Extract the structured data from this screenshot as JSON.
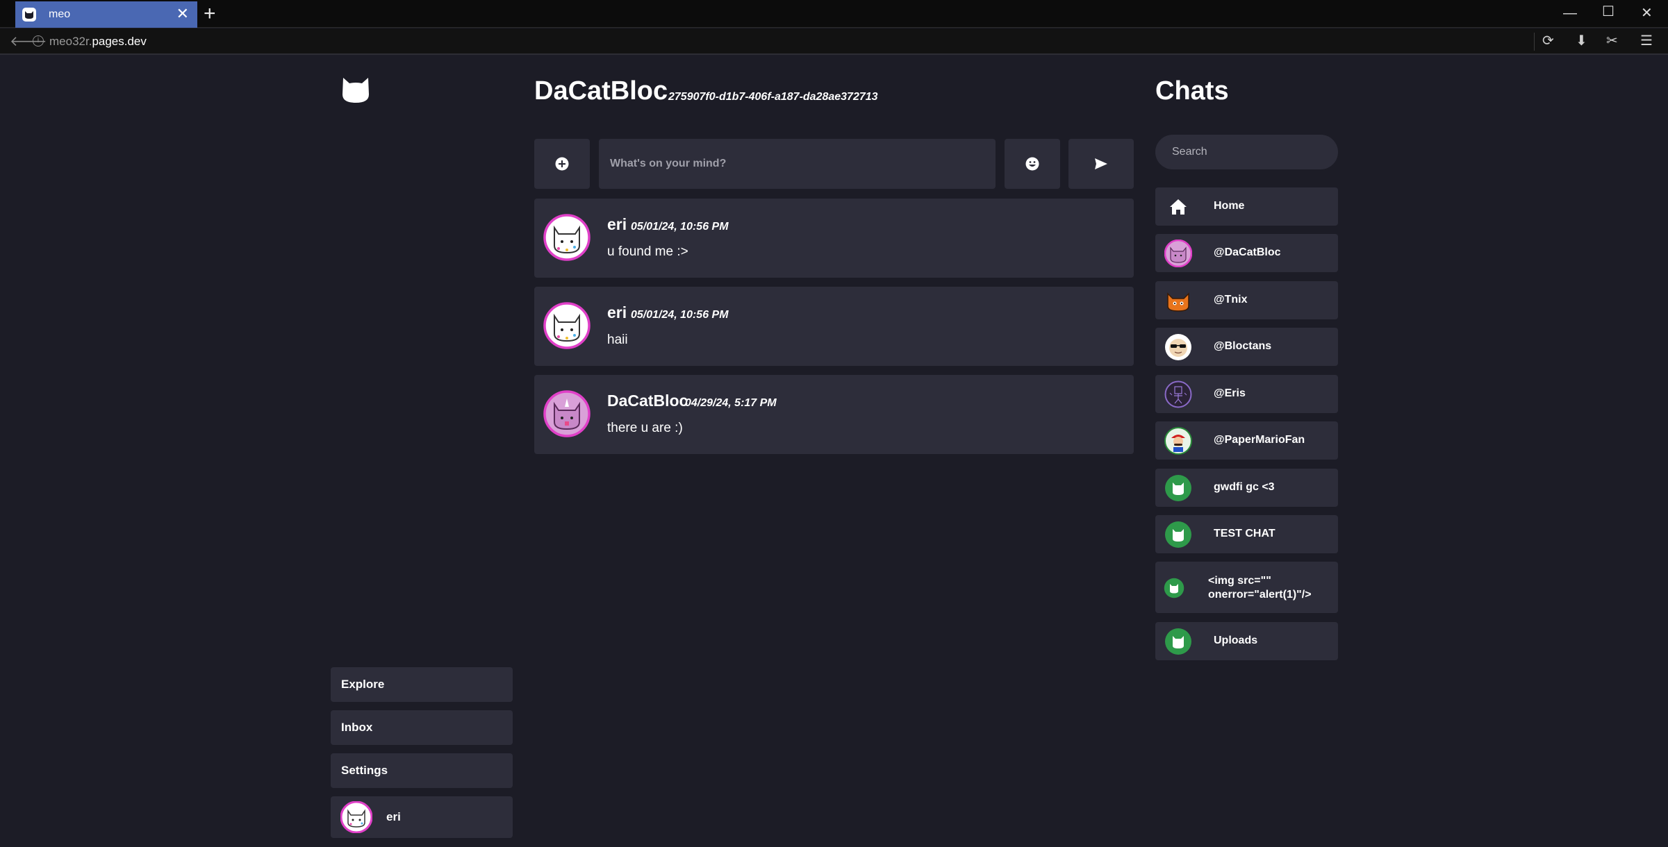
{
  "browser": {
    "tab_title": "meo",
    "url_host_prefix": "meo32r.",
    "url_host_main": "pages.dev"
  },
  "sidebar": {
    "nav": [
      {
        "label": "Explore"
      },
      {
        "label": "Inbox"
      },
      {
        "label": "Settings"
      }
    ],
    "profile_name": "eri"
  },
  "chat": {
    "title": "DaCatBloc",
    "id": "275907f0-d1b7-406f-a187-da28ae372713",
    "composer_placeholder": "What's on your mind?",
    "posts": [
      {
        "author": "eri",
        "time": "05/01/24, 10:56 PM",
        "text": "u found me :>"
      },
      {
        "author": "eri",
        "time": "05/01/24, 10:56 PM",
        "text": "haii"
      },
      {
        "author": "DaCatBloc",
        "time": "04/29/24, 5:17 PM",
        "text": "there u are :)"
      }
    ]
  },
  "chats_panel": {
    "title": "Chats",
    "search_placeholder": "Search",
    "items": [
      {
        "label": "Home",
        "icon": "home-icon"
      },
      {
        "label": "@DaCatBloc",
        "icon": "pink-cat-avatar"
      },
      {
        "label": "@Tnix",
        "icon": "orange-cat-avatar"
      },
      {
        "label": "@Bloctans",
        "icon": "sunglasses-face-avatar"
      },
      {
        "label": "@Eris",
        "icon": "purple-sketch-avatar"
      },
      {
        "label": "@PaperMarioFan",
        "icon": "mario-avatar"
      },
      {
        "label": "gwdfi gc <3",
        "icon": "group-chat-icon"
      },
      {
        "label": "TEST CHAT",
        "icon": "group-chat-icon"
      },
      {
        "label": "<img src=\"\"\nonerror=\"alert(1)\"/>",
        "icon": "group-chat-icon"
      },
      {
        "label": "Uploads",
        "icon": "group-chat-icon"
      }
    ]
  }
}
